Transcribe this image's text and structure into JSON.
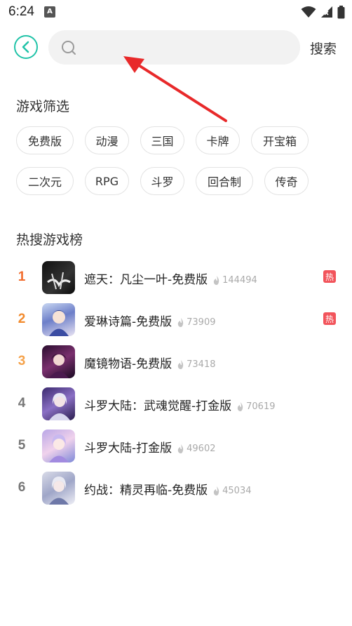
{
  "status_bar": {
    "time": "6:24",
    "app_icon_letter": "A"
  },
  "header": {
    "search_placeholder": "",
    "search_button_label": "搜索"
  },
  "filter_section": {
    "title": "游戏筛选",
    "row1": [
      "免费版",
      "动漫",
      "三国",
      "卡牌",
      "开宝箱"
    ],
    "row2": [
      "二次元",
      "RPG",
      "斗罗",
      "回合制",
      "传奇"
    ]
  },
  "hot_section": {
    "title": "热搜游戏榜",
    "items": [
      {
        "rank": "1",
        "name": "遮天：凡尘一叶-免费版",
        "heat": "144494",
        "badge": "热",
        "rank_color": "#f26b2c"
      },
      {
        "rank": "2",
        "name": "爱琳诗篇-免费版",
        "heat": "73909",
        "badge": "热",
        "rank_color": "#f28a2c"
      },
      {
        "rank": "3",
        "name": "魔镜物语-免费版",
        "heat": "73418",
        "badge": "",
        "rank_color": "#f5a24a"
      },
      {
        "rank": "4",
        "name": "斗罗大陆：武魂觉醒-打金版",
        "heat": "70619",
        "badge": "",
        "rank_color": "#777777"
      },
      {
        "rank": "5",
        "name": "斗罗大陆-打金版",
        "heat": "49602",
        "badge": "",
        "rank_color": "#777777"
      },
      {
        "rank": "6",
        "name": "约战：精灵再临-免费版",
        "heat": "45034",
        "badge": "",
        "rank_color": "#777777"
      }
    ]
  },
  "colors": {
    "accent": "#21c3a8",
    "badge": "#f2545b",
    "arrow": "#e8292a"
  }
}
